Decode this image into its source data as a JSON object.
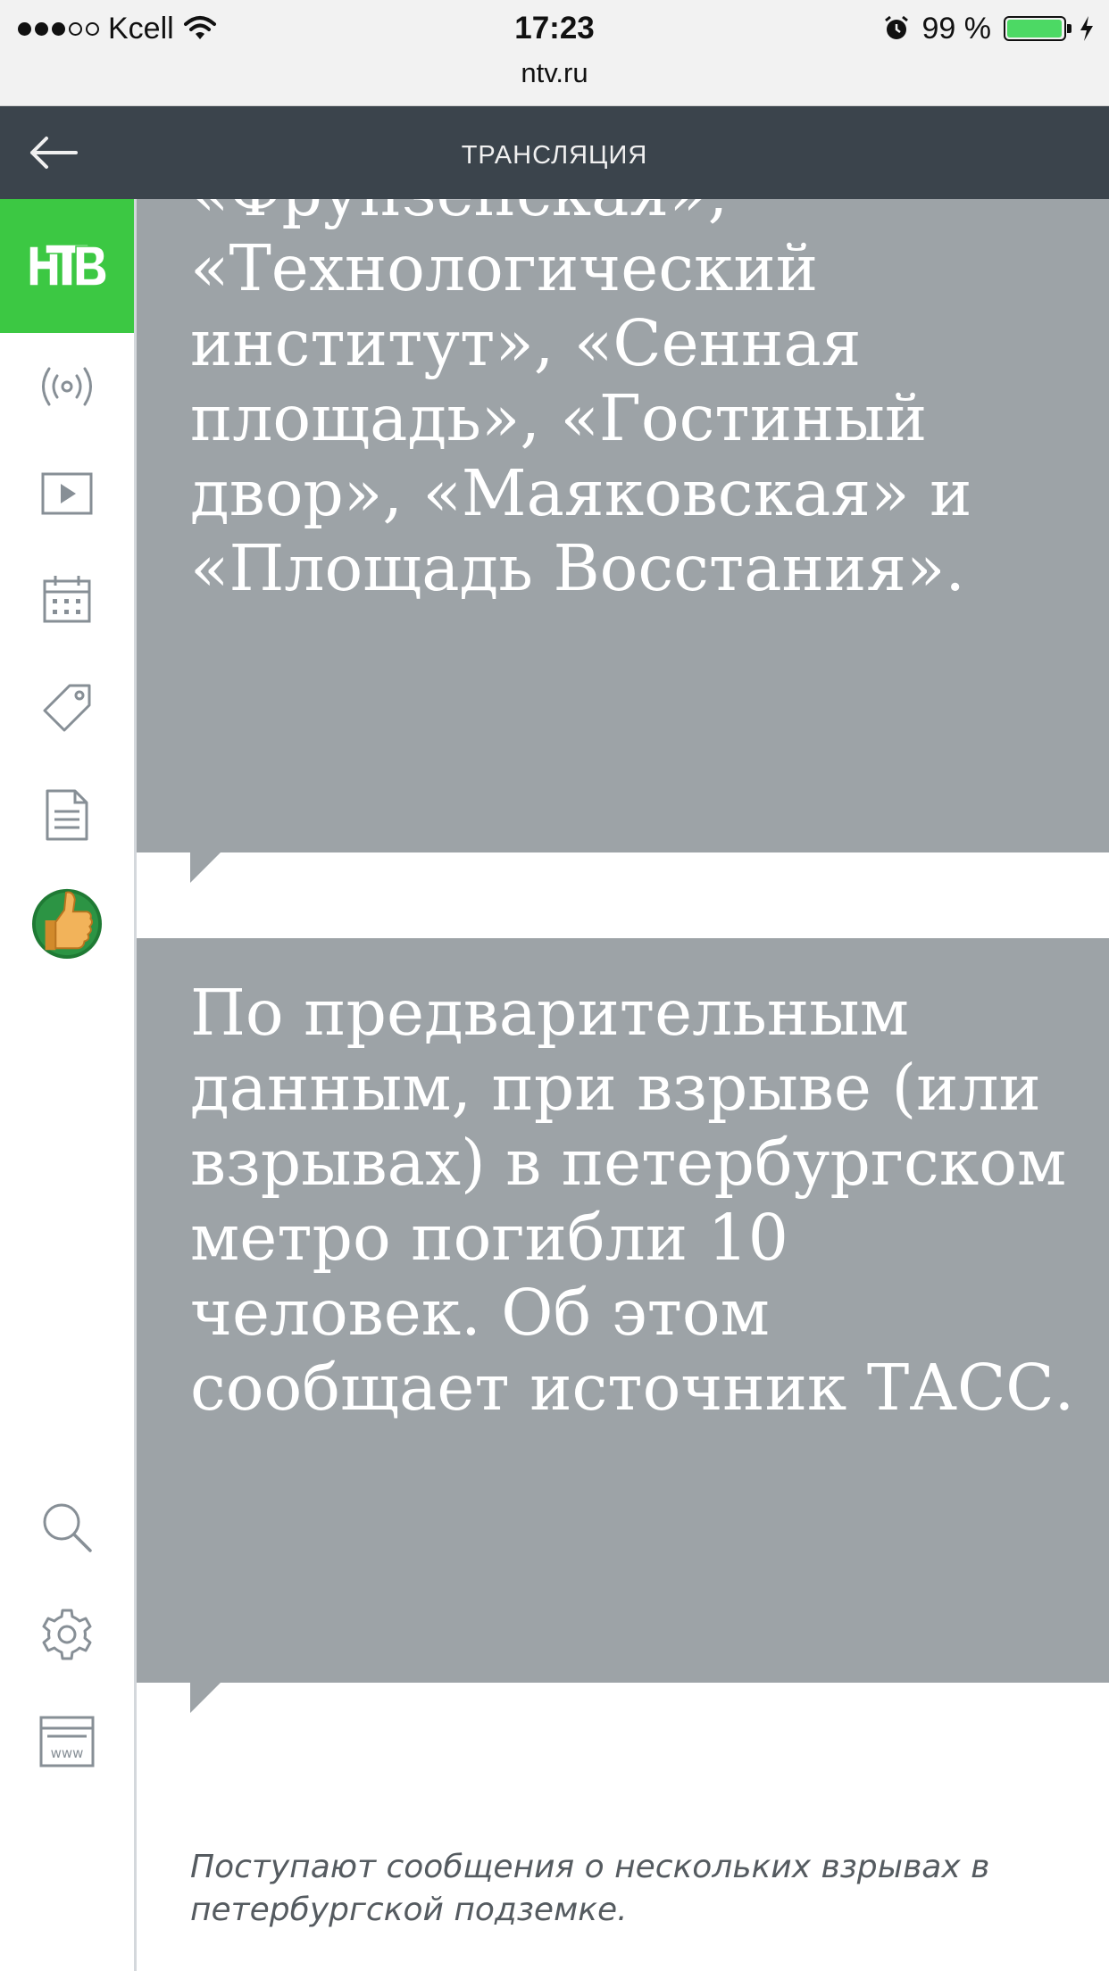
{
  "status_bar": {
    "carrier": "Kcell",
    "time": "17:23",
    "url": "ntv.ru",
    "battery_percent": "99 %",
    "battery_level": 0.99,
    "battery_color": "#4cd964",
    "icons": [
      "signal-icon",
      "wifi-icon",
      "alarm-icon",
      "battery-icon",
      "charging-icon"
    ]
  },
  "top_bar": {
    "title": "ТРАНСЛЯЦИЯ",
    "back_icon": "arrow-left-icon",
    "background": "#3b444c"
  },
  "sidebar": {
    "logo_color": "#3cc843",
    "items": [
      {
        "icon": "broadcast-icon"
      },
      {
        "icon": "play-video-icon"
      },
      {
        "icon": "calendar-icon"
      },
      {
        "icon": "tag-icon"
      },
      {
        "icon": "document-icon"
      },
      {
        "icon": "thumbs-up-icon"
      },
      {
        "icon": "search-icon"
      },
      {
        "icon": "settings-gear-icon"
      },
      {
        "icon": "www-browser-icon"
      }
    ]
  },
  "feed": {
    "card_color": "#9da3a7",
    "posts": [
      {
        "text": "«Фрунзенская», «Технологический институт», «Сенная площадь», «Гостиный двор», «Маяковская» и «Площадь Восстания»."
      },
      {
        "text": "По предварительным данным, при взрыве (или взрывах) в петербургском метро погибли 10 человек. Об этом сообщает источник ТАСС."
      }
    ],
    "caption": "Поступают сообщения о нескольких взрывах в петербургской подземке."
  }
}
